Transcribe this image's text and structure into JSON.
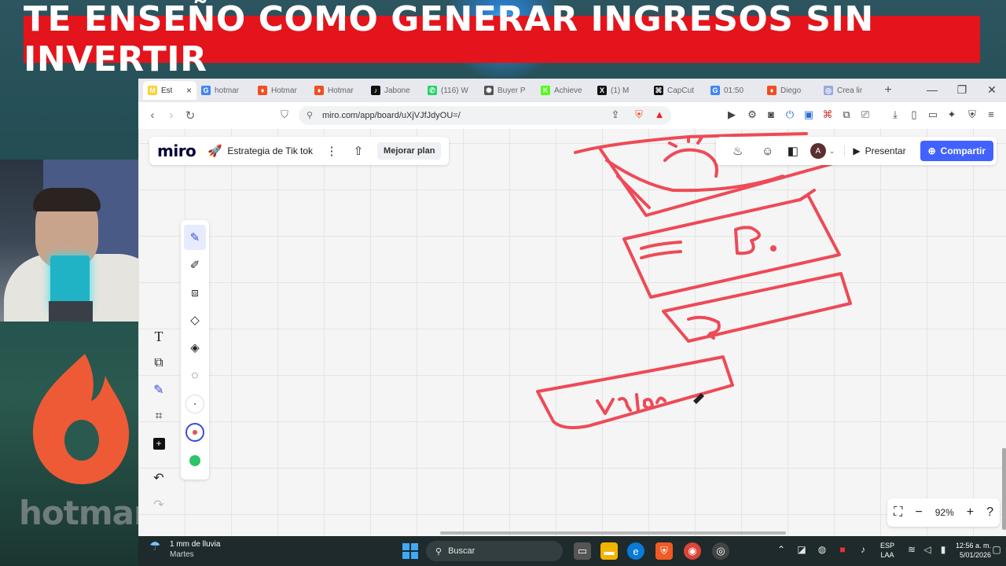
{
  "headline": "TE ENSEÑO COMO GENERAR INGRESOS SIN INVERTIR",
  "overlay": {
    "brand_word": "hotmart"
  },
  "browser": {
    "tabs": [
      {
        "label": "Est",
        "icon": "miro-icon",
        "color": "#ffd02f",
        "active": true
      },
      {
        "label": "hotmar",
        "icon": "google-icon",
        "color": "#4285f4"
      },
      {
        "label": "Hotmar",
        "icon": "hotmart-icon",
        "color": "#f04e23"
      },
      {
        "label": "Hotmar",
        "icon": "hotmart-icon",
        "color": "#f04e23"
      },
      {
        "label": "Jabone",
        "icon": "tiktok-icon",
        "color": "#111111"
      },
      {
        "label": "(116) W",
        "icon": "whatsapp-icon",
        "color": "#25d366"
      },
      {
        "label": "Buyer P",
        "icon": "openai-icon",
        "color": "#555555"
      },
      {
        "label": "Achieve",
        "icon": "k-icon",
        "color": "#53fc18"
      },
      {
        "label": "(1) M",
        "icon": "x-icon",
        "color": "#111111"
      },
      {
        "label": "CapCut",
        "icon": "capcut-icon",
        "color": "#111111"
      },
      {
        "label": "01:50",
        "icon": "google-icon",
        "color": "#4285f4"
      },
      {
        "label": "Diego",
        "icon": "hotmart-icon",
        "color": "#f04e23"
      },
      {
        "label": "Crea lir",
        "icon": "web-icon",
        "color": "#9ad"
      }
    ],
    "url": "miro.com/app/board/uXjVJfJdyOU=/"
  },
  "miro": {
    "logo": "miro",
    "board_title": "Estrategia de Tik tok",
    "upgrade_label": "Mejorar plan",
    "present_label": "Presentar",
    "share_label": "Compartir",
    "avatar_initial": "A",
    "zoom": "92%",
    "sketch_text": "Valor",
    "sketch_letter": "B."
  },
  "taskbar": {
    "weather_title": "1 mm de lluvia",
    "weather_sub": "Martes",
    "search_placeholder": "Buscar",
    "lang_top": "ESP",
    "lang_bottom": "LAA",
    "time": "12:56 a. m.",
    "date": "5/01/2026"
  },
  "colors": {
    "headline_bg": "#e3141b",
    "sketch": "#ee4a57",
    "share_button": "#4262ff"
  }
}
